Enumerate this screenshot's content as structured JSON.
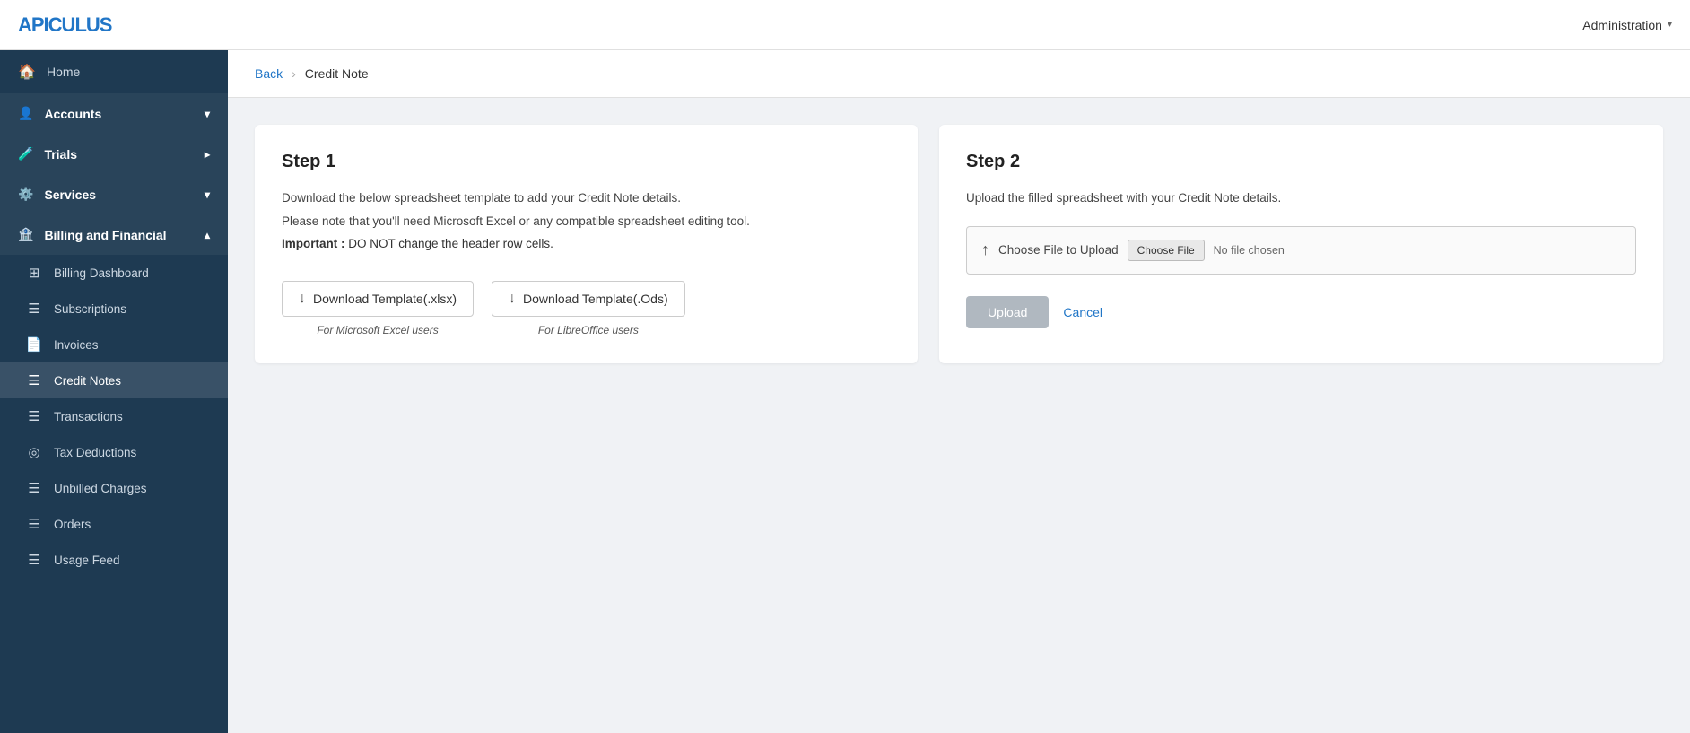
{
  "header": {
    "logo_text": "APICULUS",
    "admin_label": "Administration"
  },
  "breadcrumb": {
    "back_label": "Back",
    "separator": "Credit Note"
  },
  "sidebar": {
    "items": [
      {
        "id": "home",
        "label": "Home",
        "icon": "🏠",
        "type": "top"
      },
      {
        "id": "accounts",
        "label": "Accounts",
        "icon": "👤",
        "type": "category",
        "chevron": "▾"
      },
      {
        "id": "trials",
        "label": "Trials",
        "icon": "🧪",
        "type": "category",
        "chevron": "▸"
      },
      {
        "id": "services",
        "label": "Services",
        "icon": "⚙️",
        "type": "category",
        "chevron": "▾"
      },
      {
        "id": "billing",
        "label": "Billing and Financial",
        "icon": "🏦",
        "type": "category",
        "chevron": "▴"
      },
      {
        "id": "billing-dashboard",
        "label": "Billing Dashboard",
        "icon": "⊞"
      },
      {
        "id": "subscriptions",
        "label": "Subscriptions",
        "icon": "☰"
      },
      {
        "id": "invoices",
        "label": "Invoices",
        "icon": "📄"
      },
      {
        "id": "credit-notes",
        "label": "Credit Notes",
        "icon": "☰",
        "active": true
      },
      {
        "id": "transactions",
        "label": "Transactions",
        "icon": "☰"
      },
      {
        "id": "tax-deductions",
        "label": "Tax Deductions",
        "icon": "◎"
      },
      {
        "id": "unbilled-charges",
        "label": "Unbilled Charges",
        "icon": "☰"
      },
      {
        "id": "orders",
        "label": "Orders",
        "icon": "☰"
      },
      {
        "id": "usage-feed",
        "label": "Usage Feed",
        "icon": "☰"
      }
    ]
  },
  "step1": {
    "title": "Step 1",
    "description1": "Download the below spreadsheet template to add your Credit Note details.",
    "description2": "Please note that you'll need Microsoft Excel or any compatible spreadsheet editing tool.",
    "important_label": "Important :",
    "important_text": "DO NOT change the header row cells.",
    "btn_xlsx_label": "Download Template(.xlsx)",
    "btn_ods_label": "Download Template(.Ods)",
    "sub_xlsx": "For Microsoft Excel users",
    "sub_ods": "For LibreOffice users"
  },
  "step2": {
    "title": "Step 2",
    "description": "Upload the filled spreadsheet with your Credit Note details.",
    "choose_file_label": "Choose File to Upload",
    "choose_file_btn": "Choose File",
    "no_file_text": "No file chosen",
    "upload_btn_label": "Upload",
    "cancel_btn_label": "Cancel"
  }
}
